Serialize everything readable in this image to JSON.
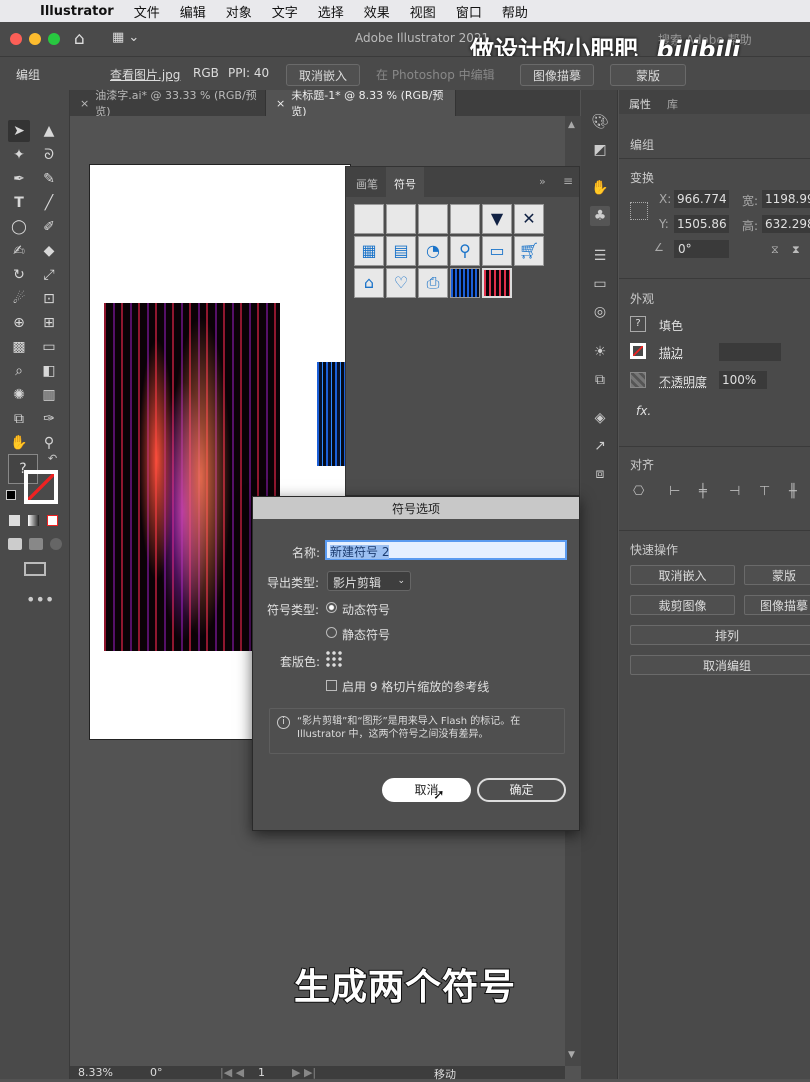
{
  "menubar": {
    "apple": "",
    "app": "Illustrator",
    "items": [
      "文件",
      "编辑",
      "对象",
      "文字",
      "选择",
      "效果",
      "视图",
      "窗口",
      "帮助"
    ]
  },
  "control": {
    "title": "Adobe Illustrator 2021",
    "search_placeholder": "搜索 Adobe 帮助"
  },
  "watermark": {
    "text": "做设计的小肥肥",
    "logo": "bilibili"
  },
  "propbar": {
    "kind": "编组",
    "link": "查看图片.jpg",
    "mode": "RGB",
    "ppi": "PPI: 40",
    "unembed": "取消嵌入",
    "edit_ps": "在 Photoshop 中编辑",
    "trace": "图像描摹",
    "mask": "蒙版"
  },
  "tabs": [
    {
      "label": "油漆字.ai* @ 33.33 % (RGB/预览)"
    },
    {
      "label": "未标题-1* @ 8.33 % (RGB/预览)"
    }
  ],
  "symbols_panel": {
    "tab_brushes": "画笔",
    "tab_symbols": "符号"
  },
  "right_panel": {
    "tab_props": "属性",
    "tab_lib": "库",
    "group": "编组",
    "transform": "变换",
    "x_label": "X:",
    "x_value": "966.774",
    "y_label": "Y:",
    "y_value": "1505.86",
    "w_label": "宽:",
    "w_value": "1198.99",
    "h_label": "高:",
    "h_value": "632.298",
    "angle": "0°",
    "appearance": "外观",
    "fill": "填色",
    "stroke": "描边",
    "opacity_label": "不透明度",
    "opacity_value": "100%",
    "fx": "fx.",
    "align": "对齐",
    "quick": "快速操作",
    "btn_unembed": "取消嵌入",
    "btn_mask": "蒙版",
    "btn_crop": "裁剪图像",
    "btn_trace": "图像描摹",
    "btn_arrange": "排列",
    "btn_ungroup": "取消编组"
  },
  "dialog": {
    "title": "符号选项",
    "name_label": "名称:",
    "name_value": "新建符号 2",
    "export_label": "导出类型:",
    "export_value": "影片剪辑",
    "symtype_label": "符号类型:",
    "dynamic": "动态符号",
    "static": "静态符号",
    "reg_label": "套版色:",
    "nine_slice": "启用 9 格切片缩放的参考线",
    "info": "“影片剪辑”和“图形”是用来导入 Flash 的标记。在 Illustrator 中，这两个符号之间没有差异。",
    "cancel": "取消",
    "ok": "确定"
  },
  "bottom": {
    "zoom": "8.33%",
    "angle": "0°",
    "page": "1",
    "status": "移动"
  },
  "subtitle": "生成两个符号",
  "colors": {
    "accent": "#1473e6",
    "bg": "#535353"
  }
}
